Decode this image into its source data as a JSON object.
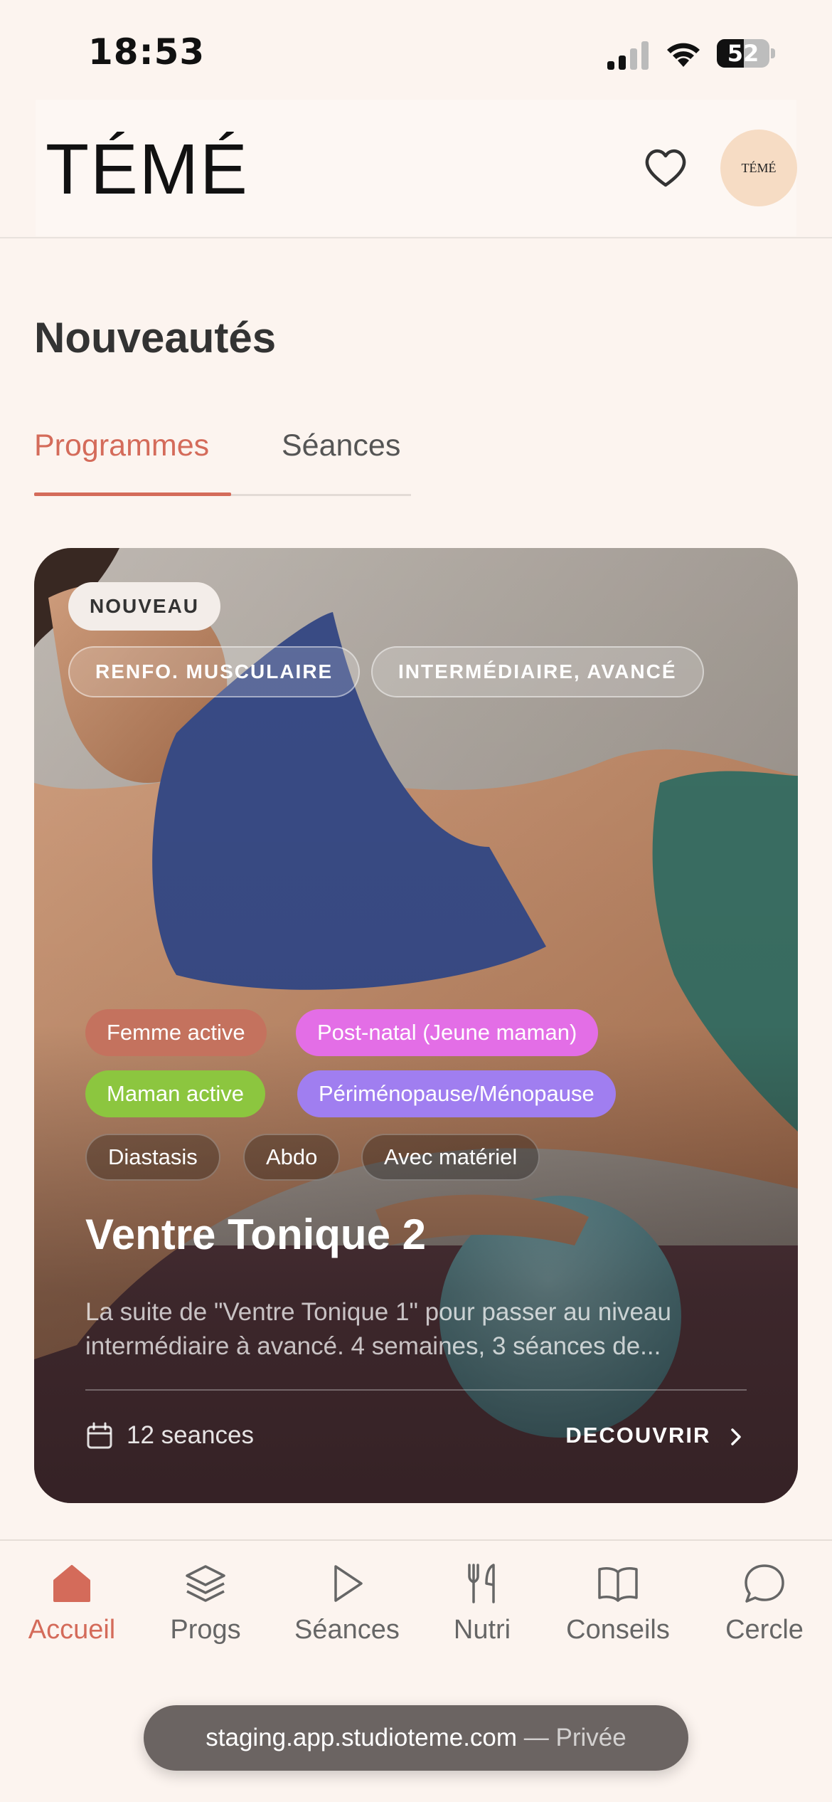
{
  "status_bar": {
    "time": "18:53",
    "battery": "52",
    "battery_level": 0.52
  },
  "header": {
    "logo": "TÉMÉ",
    "avatar_text": "TÉMÉ"
  },
  "page": {
    "title": "Nouveautés"
  },
  "tabs": [
    {
      "label": "Programmes",
      "active": true
    },
    {
      "label": "Séances",
      "active": false
    }
  ],
  "card": {
    "badge": "NOUVEAU",
    "top_tags": [
      "RENFO. MUSCULAIRE",
      "INTERMÉDIAIRE, AVANCÉ"
    ],
    "pills": [
      {
        "label": "Femme active",
        "color": "#c4725e"
      },
      {
        "label": "Post-natal (Jeune maman)",
        "color": "#e36ee6"
      },
      {
        "label": "Maman active",
        "color": "#8cc63f"
      },
      {
        "label": "Périménopause/Ménopause",
        "color": "#a07ef0"
      },
      {
        "label": "Diastasis"
      },
      {
        "label": "Abdo"
      },
      {
        "label": "Avec matériel"
      }
    ],
    "title": "Ventre Tonique 2",
    "description": "La suite de \"Ventre Tonique 1\" pour passer au niveau intermédiaire à avancé. 4 semaines, 3 séances de...",
    "sessions": "12 seances",
    "cta": "DECOUVRIR"
  },
  "nav": [
    {
      "label": "Accueil",
      "icon": "home-icon",
      "active": true
    },
    {
      "label": "Progs",
      "icon": "layers-icon"
    },
    {
      "label": "Séances",
      "icon": "play-icon"
    },
    {
      "label": "Nutri",
      "icon": "utensils-icon"
    },
    {
      "label": "Conseils",
      "icon": "book-icon"
    },
    {
      "label": "Cercle",
      "icon": "chat-icon"
    }
  ],
  "url_bar": {
    "domain": "staging.app.studioteme.com",
    "mode": "— Privée"
  },
  "colors": {
    "accent": "#d46b5a",
    "background": "#fcf4ef"
  }
}
